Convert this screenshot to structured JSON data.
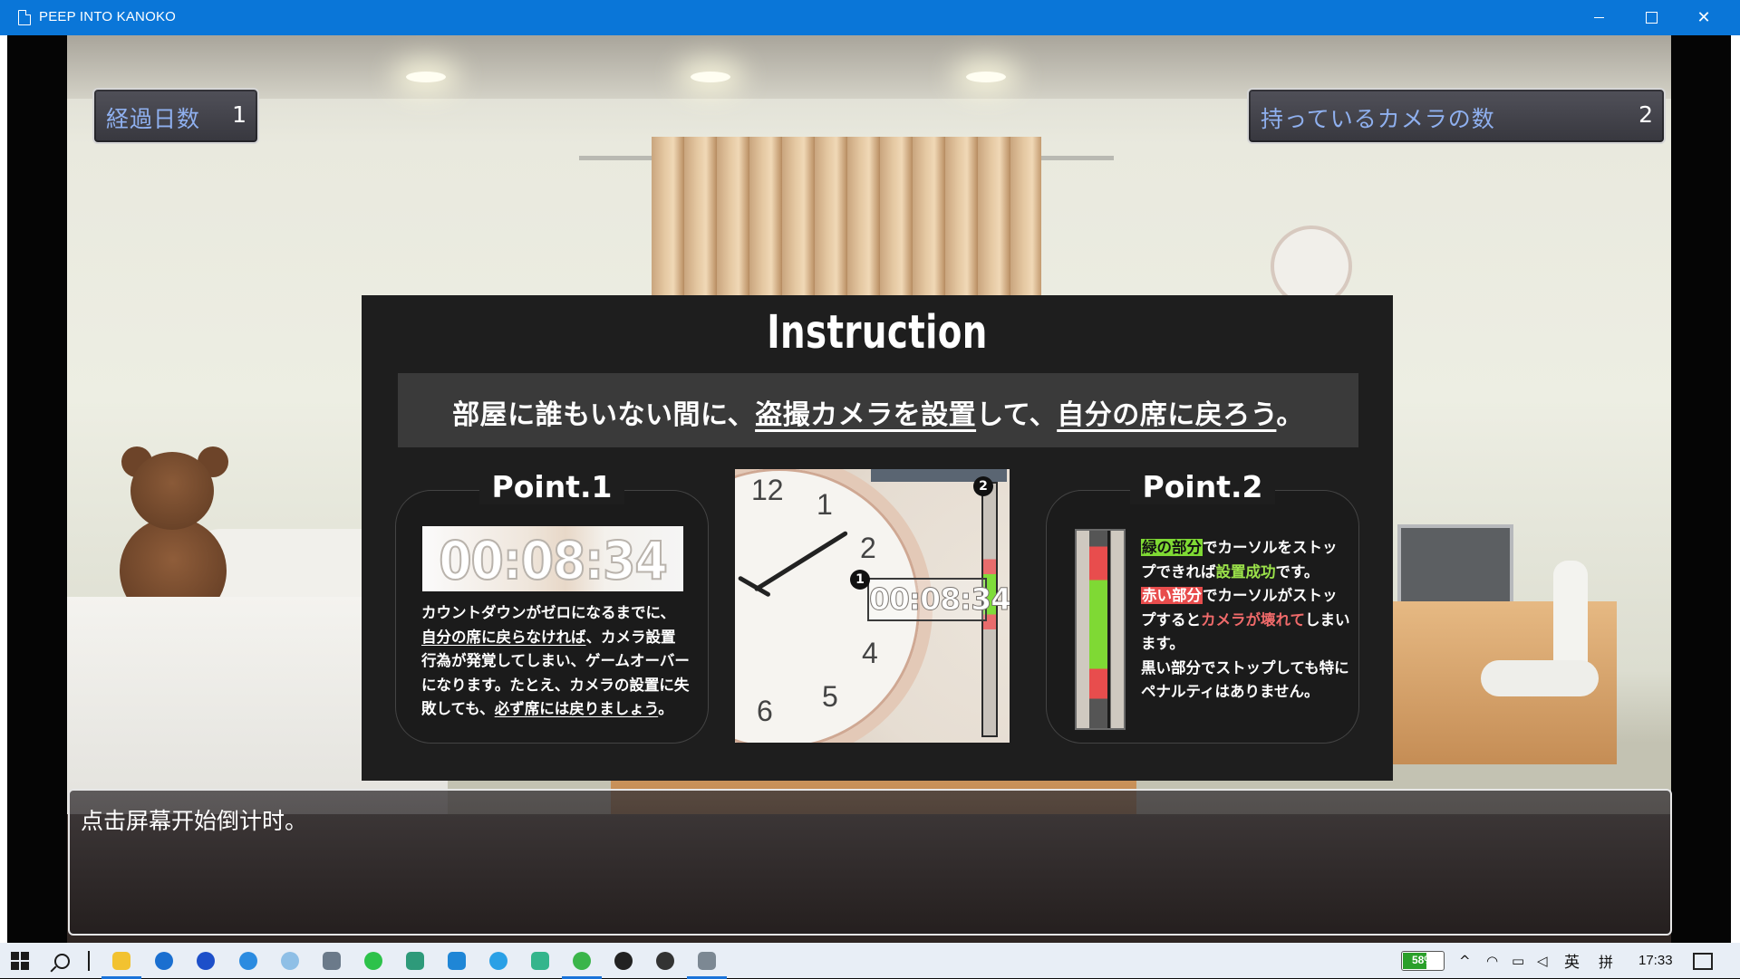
{
  "window": {
    "title": "PEEP INTO KANOKO"
  },
  "hud": {
    "days_label": "経過日数",
    "days_value": "1",
    "cameras_label": "持っているカメラの数",
    "cameras_value": "2"
  },
  "instruction": {
    "title": "Instruction",
    "banner_pre": "部屋に誰もいない間に、",
    "banner_u1": "盗撮カメラを設置",
    "banner_mid": "して、",
    "banner_u2": "自分の席に戻ろう",
    "banner_end": "。",
    "point1": {
      "heading": "Point.1",
      "timer": "00:08:34",
      "text_a": "カウントダウンがゼロになるまでに、",
      "text_u1": "自分の席に戻らなければ",
      "text_b": "、カメラ設置行為が発覚してしまい、ゲームオーバーになります。たとえ、カメラの設置に失敗しても、",
      "text_u2": "必ず席には戻りましょう",
      "text_c": "。"
    },
    "example": {
      "timer": "00:08:34",
      "marker1": "1",
      "marker2": "2",
      "clock_numbers": [
        "12",
        "1",
        "2",
        "4",
        "5",
        "6"
      ]
    },
    "point2": {
      "heading": "Point.2",
      "green_tag": "緑の部分",
      "line1_rest": "でカーソルをストップできれば",
      "success": "設置成功",
      "line2_rest": "です。",
      "red_tag": "赤い部分",
      "line3_rest": "でカーソルがストップすると",
      "broken": "カメラが壊れて",
      "line4_rest": "しまいます。",
      "line5": "黒い部分でストップしても特にペナルティはありません。"
    }
  },
  "message": {
    "text": "点击屏幕开始倒计时。"
  },
  "taskbar": {
    "battery_percent": "58%",
    "battery_level": 0.58,
    "ime_lang": "英",
    "ime_mode": "拼",
    "time": "17:33",
    "apps": [
      "file-explorer",
      "k-app",
      "l-app",
      "browser-a",
      "network-app",
      "app-six",
      "wechat",
      "app-eight",
      "app-nine",
      "ie",
      "app-eleven",
      "browser-green",
      "qq",
      "app-fourteen",
      "game-window"
    ]
  },
  "colors": {
    "titlebar": "#0a76d8",
    "stat_label": "#8fb0ef",
    "gauge_green": "#7fd934",
    "gauge_red": "#e84d4d"
  }
}
